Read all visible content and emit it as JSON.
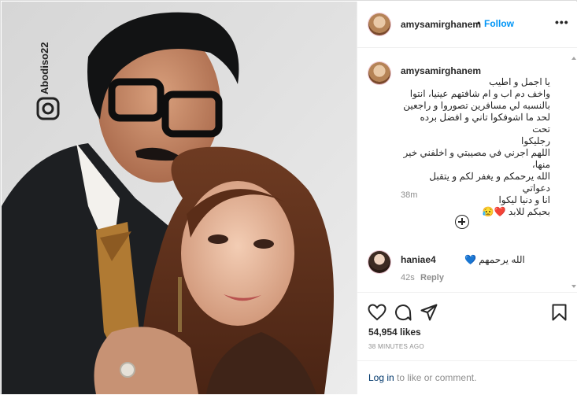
{
  "post": {
    "username": "amysamirghanem",
    "separator": "•",
    "follow_label": "Follow",
    "more_label": "•••"
  },
  "photo": {
    "watermark": "Abodiso22"
  },
  "caption": {
    "username": "amysamirghanem",
    "text": "يا اجمل و اطيب\nواخف دم اب و ام شافتهم عينيا، انتوا\nبالنسبه لي مسافرين تصوروا و راجعين\nلحد ما اشوفكوا تاني و افضل برده تحت\nرجليكوا\nاللهم اجرني في مصيبتي و اخلفني خير\nمنها،\nالله يرحمكم و يغفر لكم و يتقبل دعواتي\nانا و دنيا ليكوا\nبحبكم للابد ❤️😥",
    "time": "38m"
  },
  "comment": {
    "username": "haniae4",
    "text": "الله يرحمهم 💙",
    "time": "42s",
    "reply_label": "Reply"
  },
  "stats": {
    "likes": "54,954 likes",
    "posted": "38 MINUTES AGO"
  },
  "login_prompt": {
    "link": "Log in",
    "rest": " to like or comment."
  },
  "colors": {
    "accent": "#0095f6",
    "link": "#00376b",
    "muted": "#8e8e8e",
    "text": "#262626",
    "border": "#efefef"
  }
}
